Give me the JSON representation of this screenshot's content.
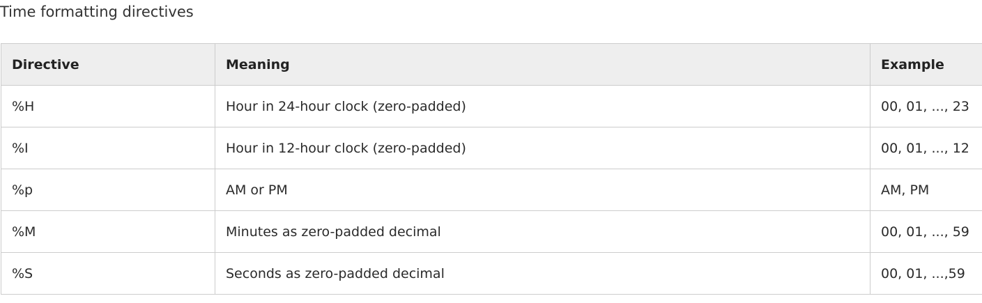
{
  "heading": "Time formatting directives",
  "table": {
    "headers": [
      "Directive",
      "Meaning",
      "Example"
    ],
    "rows": [
      [
        "%H",
        "Hour in 24-hour clock (zero-padded)",
        "00, 01, ..., 23"
      ],
      [
        "%I",
        "Hour in 12-hour clock (zero-padded)",
        "00, 01, ..., 12"
      ],
      [
        "%p",
        "AM or PM",
        "AM, PM"
      ],
      [
        "%M",
        "Minutes as zero-padded decimal",
        "00, 01, ..., 59"
      ],
      [
        "%S",
        "Seconds as zero-padded decimal",
        "00, 01, ...,59"
      ]
    ]
  }
}
